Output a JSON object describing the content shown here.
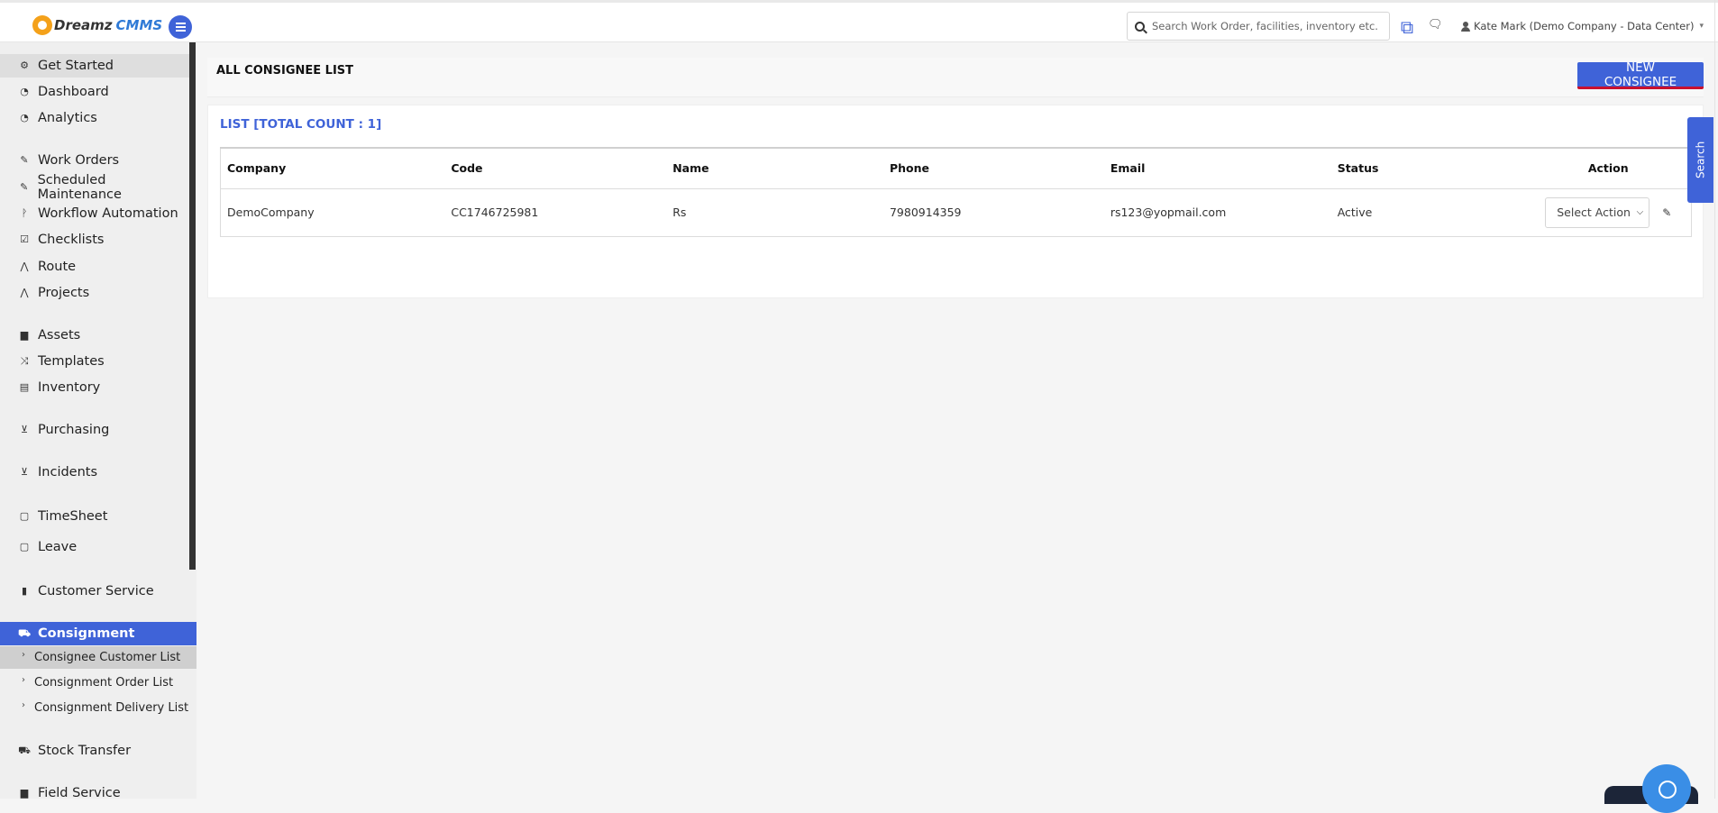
{
  "header": {
    "brand_part1": "Dreamz",
    "brand_part2": "CMMS",
    "search_placeholder": "Search Work Order, facilities, inventory etc...",
    "user_label": "Kate Mark (Demo Company - Data Center)"
  },
  "sidebar": {
    "items": [
      {
        "label": "Get Started",
        "icon": "gears-icon"
      },
      {
        "label": "Dashboard",
        "icon": "dashboard-icon"
      },
      {
        "label": "Analytics",
        "icon": "analytics-icon"
      },
      {
        "label": "Work Orders",
        "icon": "wrench-icon"
      },
      {
        "label": "Scheduled Maintenance",
        "icon": "wrench-icon"
      },
      {
        "label": "Workflow Automation",
        "icon": "branch-icon"
      },
      {
        "label": "Checklists",
        "icon": "checkbox-icon"
      },
      {
        "label": "Route",
        "icon": "road-icon"
      },
      {
        "label": "Projects",
        "icon": "road-icon"
      },
      {
        "label": "Assets",
        "icon": "archive-icon"
      },
      {
        "label": "Templates",
        "icon": "shuffle-icon"
      },
      {
        "label": "Inventory",
        "icon": "briefcase-icon"
      },
      {
        "label": "Purchasing",
        "icon": "cart-icon"
      },
      {
        "label": "Incidents",
        "icon": "cart-icon"
      },
      {
        "label": "TimeSheet",
        "icon": "calendar-icon"
      },
      {
        "label": "Leave",
        "icon": "calendar-icon"
      },
      {
        "label": "Customer Service",
        "icon": "file-icon"
      },
      {
        "label": "Consignment",
        "icon": "truck-icon"
      },
      {
        "label": "Stock Transfer",
        "icon": "truck-icon"
      },
      {
        "label": "Field Service",
        "icon": "archive-icon"
      }
    ],
    "sub_items": [
      {
        "label": "Consignee Customer List"
      },
      {
        "label": "Consignment Order List"
      },
      {
        "label": "Consignment Delivery List"
      }
    ]
  },
  "page": {
    "title": "ALL CONSIGNEE LIST",
    "new_button": "NEW CONSIGNEE",
    "list_title": "LIST [TOTAL COUNT : 1]",
    "search_tab": "Search"
  },
  "table": {
    "headers": [
      "Company",
      "Code",
      "Name",
      "Phone",
      "Email",
      "Status",
      "Action"
    ],
    "rows": [
      {
        "company": "DemoCompany",
        "code": "CC1746725981",
        "name": "Rs",
        "phone": "7980914359",
        "email": "rs123@yopmail.com",
        "status": "Active",
        "action": "Select Action"
      }
    ]
  }
}
